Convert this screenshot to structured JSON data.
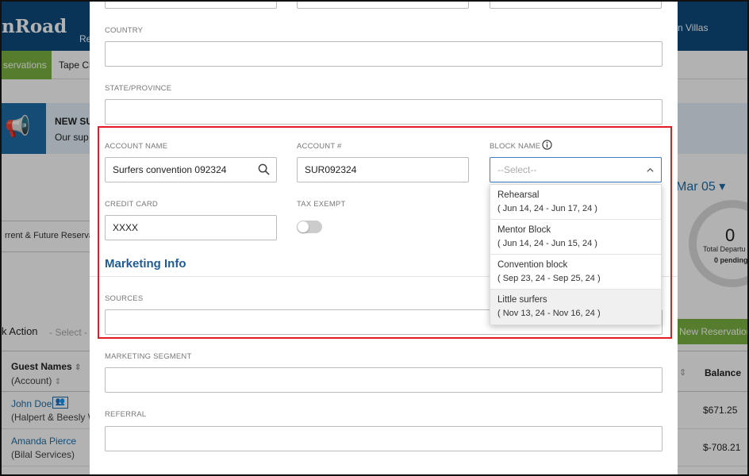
{
  "background": {
    "logo": "nRoad",
    "header_fragment": "Re",
    "property_name": "n Villas",
    "tabs": {
      "active": "servations",
      "next": "Tape Cl"
    },
    "banner": {
      "title": "NEW SU",
      "text": "Our sup"
    },
    "filter_text": "rrent & Future Reserva",
    "date_nav": "Mar 05",
    "departures": {
      "count": "0",
      "label": "Total Departu",
      "pending": "0 pending"
    },
    "bulk_action": {
      "label": "k Action",
      "select": "- Select -"
    },
    "new_reservation_button": "New Reservation",
    "table": {
      "col_guest": "Guest Names",
      "col_account": "(Account)",
      "col_balance": "Balance",
      "rows": [
        {
          "name": "John Doe",
          "company": "(Halpert & Beesly W",
          "balance": "$671.25"
        },
        {
          "name": "Amanda Pierce",
          "company": "(Bilal Services)",
          "balance": "$-708.21"
        }
      ]
    }
  },
  "modal": {
    "country_label": "COUNTRY",
    "country_value": "",
    "state_label": "STATE/PROVINCE",
    "state_value": "",
    "account_name_label": "ACCOUNT NAME",
    "account_name_value": "Surfers convention 092324",
    "account_number_label": "ACCOUNT #",
    "account_number_value": "SUR092324",
    "block_name_label": "BLOCK NAME",
    "block_name_placeholder": "--Select--",
    "credit_card_label": "CREDIT CARD",
    "credit_card_value": "XXXX",
    "tax_exempt_label": "TAX EXEMPT",
    "tax_exempt_on": false,
    "marketing_title": "Marketing Info",
    "sources_label": "SOURCES",
    "marketing_segment_label": "MARKETING SEGMENT",
    "referral_label": "REFERRAL",
    "block_options": [
      {
        "name": "Rehearsal",
        "dates": "( Jun 14, 24 - Jun 17, 24 )"
      },
      {
        "name": "Mentor Block",
        "dates": "( Jun 14, 24 - Jun 15, 24 )"
      },
      {
        "name": "Convention block",
        "dates": "( Sep 23, 24 - Sep 25, 24 )"
      },
      {
        "name": "Little surfers",
        "dates": "( Nov 13, 24 - Nov 16, 24 )"
      }
    ]
  },
  "colors": {
    "header_blue": "#0f4b7d",
    "accent_green": "#7cb342",
    "link_blue": "#1d6ea8",
    "highlight_red": "#e31b23",
    "section_title": "#1d5c93"
  }
}
